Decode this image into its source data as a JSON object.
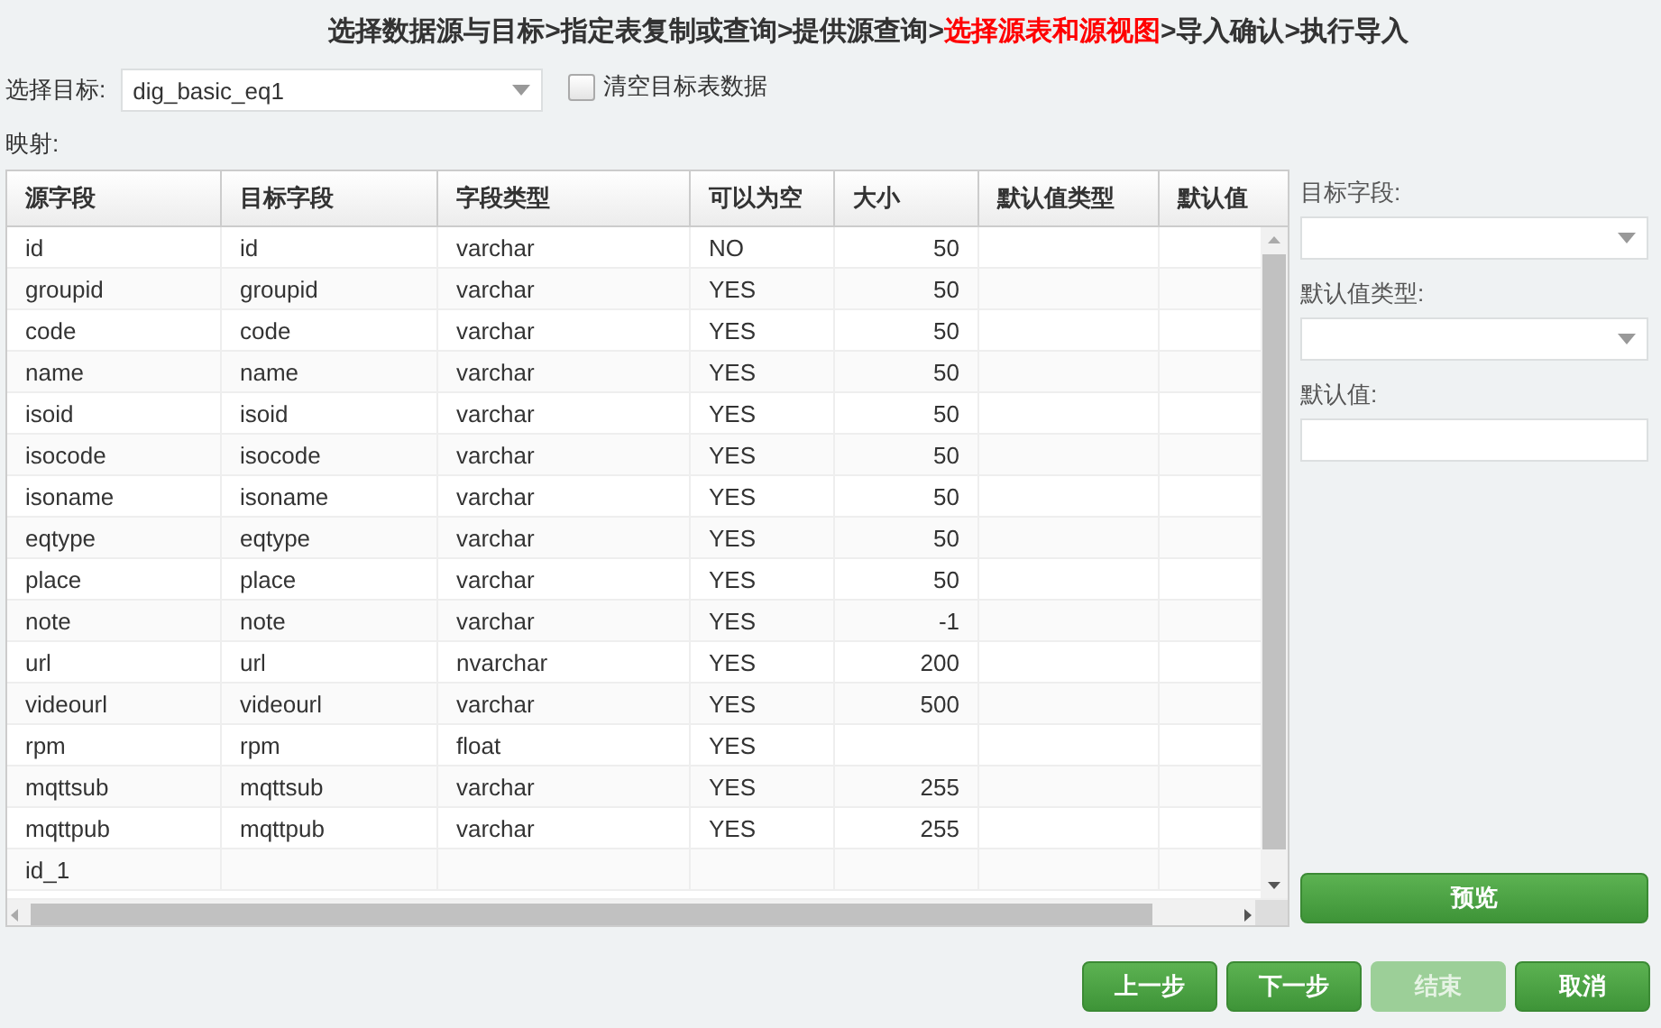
{
  "wizard_steps": {
    "separator": ">",
    "steps": [
      {
        "label": "选择数据源与目标",
        "selected": false
      },
      {
        "label": "指定表复制或查询",
        "selected": false
      },
      {
        "label": "提供源查询",
        "selected": false
      },
      {
        "label": "选择源表和源视图",
        "selected": true
      },
      {
        "label": "导入确认",
        "selected": false
      },
      {
        "label": "执行导入",
        "selected": false
      }
    ]
  },
  "target": {
    "label": "选择目标:",
    "value": "dig_basic_eq1"
  },
  "clear_target": {
    "label": "清空目标表数据",
    "checked": false
  },
  "mapping_label": "映射:",
  "table": {
    "columns": [
      "源字段",
      "目标字段",
      "字段类型",
      "可以为空",
      "大小",
      "默认值类型",
      "默认值"
    ],
    "rows": [
      [
        "id",
        "id",
        "varchar",
        "NO",
        "50",
        "",
        ""
      ],
      [
        "groupid",
        "groupid",
        "varchar",
        "YES",
        "50",
        "",
        ""
      ],
      [
        "code",
        "code",
        "varchar",
        "YES",
        "50",
        "",
        ""
      ],
      [
        "name",
        "name",
        "varchar",
        "YES",
        "50",
        "",
        ""
      ],
      [
        "isoid",
        "isoid",
        "varchar",
        "YES",
        "50",
        "",
        ""
      ],
      [
        "isocode",
        "isocode",
        "varchar",
        "YES",
        "50",
        "",
        ""
      ],
      [
        "isoname",
        "isoname",
        "varchar",
        "YES",
        "50",
        "",
        ""
      ],
      [
        "eqtype",
        "eqtype",
        "varchar",
        "YES",
        "50",
        "",
        ""
      ],
      [
        "place",
        "place",
        "varchar",
        "YES",
        "50",
        "",
        ""
      ],
      [
        "note",
        "note",
        "varchar",
        "YES",
        "-1",
        "",
        ""
      ],
      [
        "url",
        "url",
        "nvarchar",
        "YES",
        "200",
        "",
        ""
      ],
      [
        "videourl",
        "videourl",
        "varchar",
        "YES",
        "500",
        "",
        ""
      ],
      [
        "rpm",
        "rpm",
        "float",
        "YES",
        "",
        "",
        ""
      ],
      [
        "mqttsub",
        "mqttsub",
        "varchar",
        "YES",
        "255",
        "",
        ""
      ],
      [
        "mqttpub",
        "mqttpub",
        "varchar",
        "YES",
        "255",
        "",
        ""
      ],
      [
        "id_1",
        "",
        "",
        "",
        "",
        "",
        ""
      ]
    ]
  },
  "editor": {
    "target_field_label": "目标字段:",
    "default_type_label": "默认值类型:",
    "default_value_label": "默认值:",
    "preview_button": "预览"
  },
  "buttons": [
    {
      "label": "上一步",
      "disabled": false
    },
    {
      "label": "下一步",
      "disabled": false
    },
    {
      "label": "结束",
      "disabled": true
    },
    {
      "label": "取消",
      "disabled": false
    }
  ]
}
